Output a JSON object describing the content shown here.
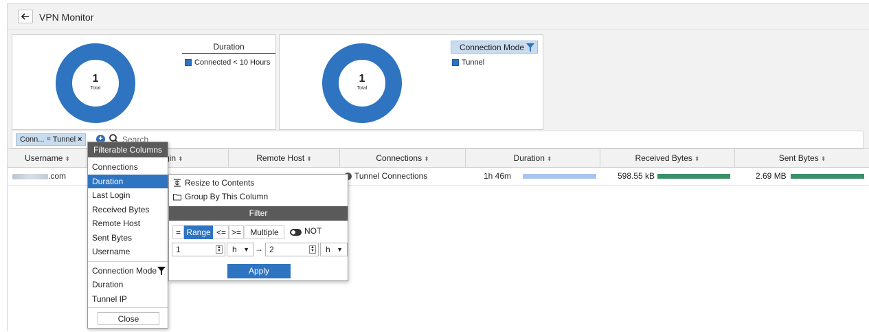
{
  "header": {
    "title": "VPN Monitor",
    "back_icon": "arrow-left-icon"
  },
  "duration_panel": {
    "legend_title": "Duration",
    "center_value": "1",
    "center_label": "Total",
    "legend": [
      "Connected < 10 Hours"
    ],
    "color": "#2e74c0"
  },
  "mode_panel": {
    "legend_title": "Connection Mode",
    "center_value": "1",
    "center_label": "Total",
    "legend": [
      "Tunnel"
    ],
    "color": "#2e74c0"
  },
  "search": {
    "chip_label": "Conn... = Tunnel",
    "chip_close": "×",
    "placeholder": "Search"
  },
  "table": {
    "columns": [
      "Username",
      "gin",
      "Remote Host",
      "Connections",
      "Duration",
      "Received Bytes",
      "Sent Bytes"
    ],
    "row": {
      "username": ".com",
      "connections": "Tunnel Connections",
      "duration": "1h 46m",
      "received": "598.55 kB",
      "sent": "2.69 MB"
    }
  },
  "filter_menu": {
    "title": "Filterable Columns",
    "group1": [
      "Connections",
      "Duration",
      "Last Login",
      "Received Bytes",
      "Remote Host",
      "Sent Bytes",
      "Username"
    ],
    "group2": [
      "Connection Mode",
      "Duration",
      "Tunnel IP"
    ],
    "active_item": "Duration",
    "close_label": "Close"
  },
  "sub_menu": {
    "resize_label": "Resize to Contents",
    "group_label": "Group By This Column",
    "filter_title": "Filter",
    "operators": [
      "=",
      "Range",
      "<=",
      ">=",
      "Multiple"
    ],
    "selected_operator": "Range",
    "not_label": "NOT",
    "from_value": "1",
    "from_unit": "h",
    "arrow": "→",
    "to_value": "2",
    "to_unit": "h",
    "apply_label": "Apply"
  },
  "colors": {
    "accent": "#2e74c0",
    "duration_bar": "#a9c4f0",
    "bytes_bar": "#3c9068"
  }
}
